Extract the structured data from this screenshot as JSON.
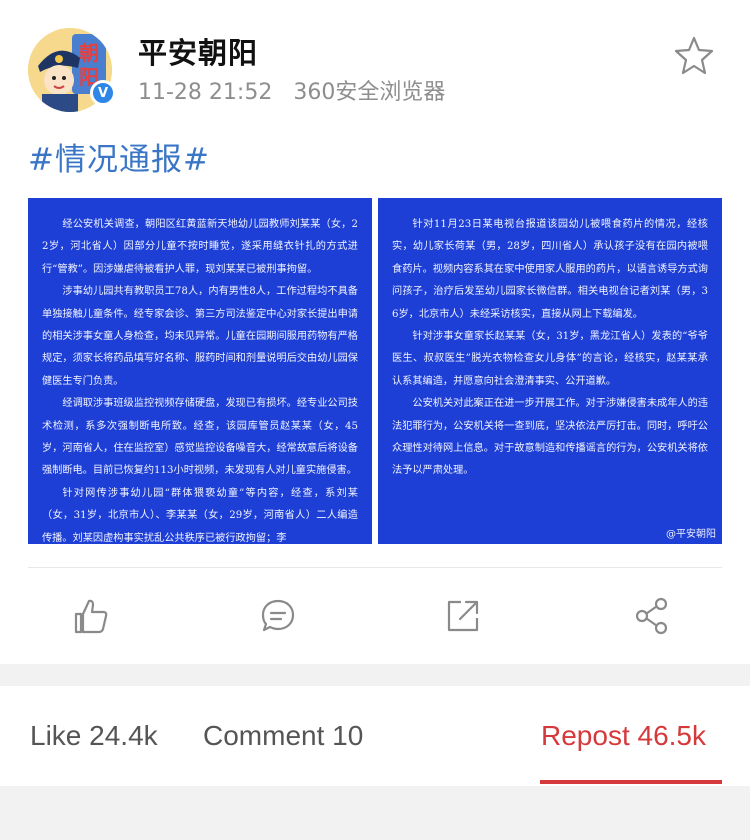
{
  "post": {
    "author": "平安朝阳",
    "time": "11-28 21:52",
    "source": "360安全浏览器",
    "hashtag": "#情况通报#",
    "avatar_text": "朝阳",
    "verified_badge": "V",
    "images": {
      "left_paragraphs": [
        "经公安机关调查，朝阳区红黄蓝新天地幼儿园教师刘某某（女，22岁，河北省人）因部分儿童不按时睡觉，遂采用缝衣针扎的方式进行“管教”。因涉嫌虐待被看护人罪，现刘某某已被刑事拘留。",
        "涉事幼儿园共有教职员工78人，内有男性8人，工作过程均不具备单独接触儿童条件。经专家会诊、第三方司法鉴定中心对家长提出申请的相关涉事女童人身检查，均未见异常。儿童在园期间服用药物有严格规定，须家长将药品填写好名称、服药时间和剂量说明后交由幼儿园保健医生专门负责。",
        "经调取涉事班级监控视频存储硬盘，发现已有损坏。经专业公司技术检测，系多次强制断电所致。经查，该园库管员赵某某（女，45岁，河南省人，住在监控室）感觉监控设备噪音大，经常故意后将设备强制断电。目前已恢复约113小时视频，未发现有人对儿童实施侵害。",
        "针对网传涉事幼儿园“群体猥亵幼童”等内容，经查，系刘某（女，31岁，北京市人）、李某某（女，29岁，河南省人）二人编造传播。刘某因虚构事实扰乱公共秩序已被行政拘留；李"
      ],
      "right_paragraphs": [
        "针对11月23日某电视台报道该园幼儿被喂食药片的情况，经核实，幼儿家长荷某（男，28岁，四川省人）承认孩子没有在园内被喂食药片。视频内容系其在家中使用家人服用的药片，以语言诱导方式询问孩子，治疗后发至幼儿园家长微信群。相关电视台记者刘某（男，36岁，北京市人）未经采访核实，直接从网上下载编发。",
        "针对涉事女童家长赵某某（女，31岁，黑龙江省人）发表的“爷爷医生、叔叔医生”脱光衣物检查女儿身体”的言论，经核实，赵某某承认系其编造，并愿意向社会澄清事实、公开道歉。",
        "公安机关对此案正在进一步开展工作。对于涉嫌侵害未成年人的违法犯罪行为，公安机关将一查到底，坚决依法严厉打击。同时，呼吁公众理性对待网上信息。对于故意制造和传播谣言的行为，公安机关将依法予以严肃处理。"
      ],
      "watermark": "@平安朝阳"
    }
  },
  "icons": {
    "star": "star-icon",
    "like": "thumbs-up-icon",
    "comment": "comment-bubble-icon",
    "repost": "share-arrow-icon",
    "share": "share-nodes-icon"
  },
  "tabs": {
    "like": "Like 24.4k",
    "comment": "Comment 10",
    "repost": "Repost 46.5k",
    "active": "repost"
  },
  "colors": {
    "accent": "#d6393b",
    "hashtag": "#3a76c5",
    "notice_bg": "#1d3fd6",
    "verified": "#2e86e6"
  }
}
